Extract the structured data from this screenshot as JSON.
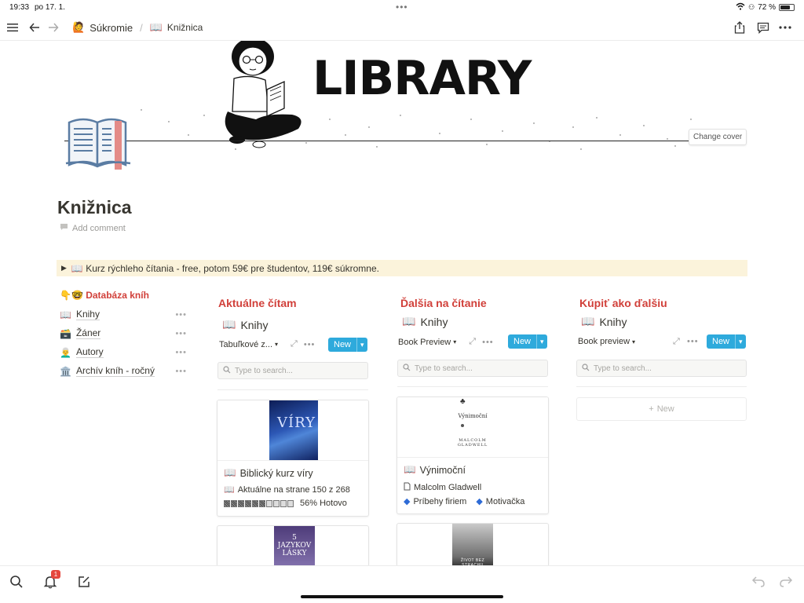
{
  "status": {
    "time": "19:33",
    "date": "po 17. 1.",
    "battery": "72 %",
    "battery_level": 0.72
  },
  "toolbar": {
    "crumb_parent": "Súkromie",
    "crumb_current": "Knižnica"
  },
  "cover": {
    "banner_text": "LIBRARY",
    "change_cover": "Change cover"
  },
  "page": {
    "title": "Knižnica",
    "add_comment": "Add comment"
  },
  "callout": {
    "text": "📖 Kurz rýchleho čítania - free, potom 59€ pre študentov, 119€ súkromne."
  },
  "sidebar": {
    "heading": "👇🤓 Databáza kníh",
    "items": [
      {
        "icon": "📖",
        "label": "Knihy"
      },
      {
        "icon": "🗃️",
        "label": "Žáner"
      },
      {
        "icon": "👨‍🦳",
        "label": "Autory"
      },
      {
        "icon": "🏛️",
        "label": "Archív kníh - ročný"
      }
    ]
  },
  "columns": [
    {
      "heading": "Aktuálne čítam",
      "db_title": "Knihy",
      "view": "Tabuľkové z...",
      "new": "New",
      "search_placeholder": "Type to search...",
      "cards": [
        {
          "cover_text": "VÍRY",
          "title": "Biblický kurz víry",
          "prop1": "Aktuálne na strane 150 z 268",
          "progress_text": "56% Hotovo",
          "progress": 0.56
        }
      ],
      "second_cover_text": "5 JAZYKOV LÁSKY"
    },
    {
      "heading": "Ďalšia na čítanie",
      "db_title": "Knihy",
      "view": "Book Preview",
      "new": "New",
      "search_placeholder": "Type to search...",
      "cards": [
        {
          "cover_title": "Výnimoční",
          "cover_author": "Malcolm Gladwell",
          "title": "Výnimoční",
          "author": "Malcolm Gladwell",
          "tags": [
            "Príbehy firiem",
            "Motivačka"
          ]
        }
      ],
      "second_cover_text": "ŽIVOT BEZ STRACHU"
    },
    {
      "heading": "Kúpiť ako ďalšiu",
      "db_title": "Knihy",
      "view": "Book preview",
      "new": "New",
      "search_placeholder": "Type to search...",
      "add_row": "New"
    }
  ],
  "colors": {
    "accent": "#2eaadc",
    "heading_red": "#d1403a",
    "callout_bg": "#fbf3db"
  }
}
